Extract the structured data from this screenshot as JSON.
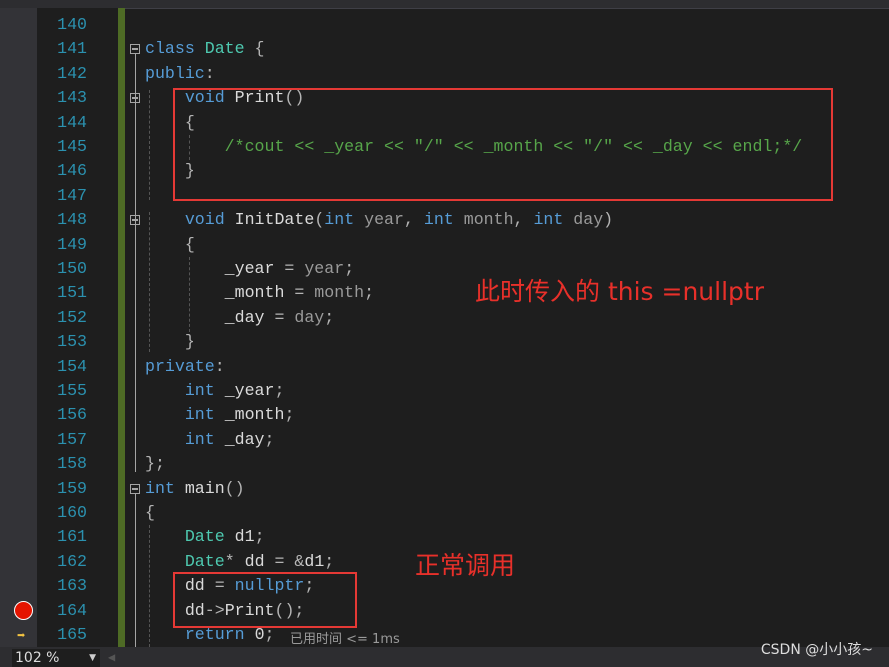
{
  "editor": {
    "lines": [
      {
        "n": "140",
        "tokens": []
      },
      {
        "n": "141",
        "tokens": [
          [
            "class ",
            "k"
          ],
          [
            "Date",
            "t"
          ],
          [
            " {",
            "o"
          ]
        ]
      },
      {
        "n": "142",
        "tokens": [
          [
            "public",
            "k"
          ],
          [
            ":",
            "o"
          ]
        ]
      },
      {
        "n": "143",
        "tokens": [
          [
            "    ",
            ""
          ],
          [
            "void ",
            "k"
          ],
          [
            "Print",
            "f"
          ],
          [
            "()",
            "o"
          ]
        ]
      },
      {
        "n": "144",
        "tokens": [
          [
            "    ",
            ""
          ],
          [
            "{",
            "o"
          ]
        ]
      },
      {
        "n": "145",
        "tokens": [
          [
            "        ",
            ""
          ],
          [
            "/*cout << _year << \"/\" << _month << \"/\" << _day << endl;*/",
            "c"
          ]
        ]
      },
      {
        "n": "146",
        "tokens": [
          [
            "    ",
            ""
          ],
          [
            "}",
            "o"
          ]
        ]
      },
      {
        "n": "147",
        "tokens": []
      },
      {
        "n": "148",
        "tokens": [
          [
            "    ",
            ""
          ],
          [
            "void ",
            "k"
          ],
          [
            "InitDate",
            "f"
          ],
          [
            "(",
            "o"
          ],
          [
            "int ",
            "k"
          ],
          [
            "year",
            "p"
          ],
          [
            ", ",
            "o"
          ],
          [
            "int ",
            "k"
          ],
          [
            "month",
            "p"
          ],
          [
            ", ",
            "o"
          ],
          [
            "int ",
            "k"
          ],
          [
            "day",
            "p"
          ],
          [
            ")",
            "o"
          ]
        ]
      },
      {
        "n": "149",
        "tokens": [
          [
            "    ",
            ""
          ],
          [
            "{",
            "o"
          ]
        ]
      },
      {
        "n": "150",
        "tokens": [
          [
            "        ",
            ""
          ],
          [
            "_year",
            "f"
          ],
          [
            " = ",
            "o"
          ],
          [
            "year",
            "p"
          ],
          [
            ";",
            "o"
          ]
        ]
      },
      {
        "n": "151",
        "tokens": [
          [
            "        ",
            ""
          ],
          [
            "_month",
            "f"
          ],
          [
            " = ",
            "o"
          ],
          [
            "month",
            "p"
          ],
          [
            ";",
            "o"
          ]
        ]
      },
      {
        "n": "152",
        "tokens": [
          [
            "        ",
            ""
          ],
          [
            "_day",
            "f"
          ],
          [
            " = ",
            "o"
          ],
          [
            "day",
            "p"
          ],
          [
            ";",
            "o"
          ]
        ]
      },
      {
        "n": "153",
        "tokens": [
          [
            "    ",
            ""
          ],
          [
            "}",
            "o"
          ]
        ]
      },
      {
        "n": "154",
        "tokens": [
          [
            "private",
            "k"
          ],
          [
            ":",
            "o"
          ]
        ]
      },
      {
        "n": "155",
        "tokens": [
          [
            "    ",
            ""
          ],
          [
            "int ",
            "k"
          ],
          [
            "_year",
            "f"
          ],
          [
            ";",
            "o"
          ]
        ]
      },
      {
        "n": "156",
        "tokens": [
          [
            "    ",
            ""
          ],
          [
            "int ",
            "k"
          ],
          [
            "_month",
            "f"
          ],
          [
            ";",
            "o"
          ]
        ]
      },
      {
        "n": "157",
        "tokens": [
          [
            "    ",
            ""
          ],
          [
            "int ",
            "k"
          ],
          [
            "_day",
            "f"
          ],
          [
            ";",
            "o"
          ]
        ]
      },
      {
        "n": "158",
        "tokens": [
          [
            "};",
            "o"
          ]
        ]
      },
      {
        "n": "159",
        "tokens": [
          [
            "int ",
            "k"
          ],
          [
            "main",
            "f"
          ],
          [
            "()",
            "o"
          ]
        ]
      },
      {
        "n": "160",
        "tokens": [
          [
            "{",
            "o"
          ]
        ]
      },
      {
        "n": "161",
        "tokens": [
          [
            "    ",
            ""
          ],
          [
            "Date ",
            "t"
          ],
          [
            "d1",
            "f"
          ],
          [
            ";",
            "o"
          ]
        ]
      },
      {
        "n": "162",
        "tokens": [
          [
            "    ",
            ""
          ],
          [
            "Date",
            "t"
          ],
          [
            "* ",
            "o"
          ],
          [
            "dd",
            "f"
          ],
          [
            " = &",
            "o"
          ],
          [
            "d1",
            "f"
          ],
          [
            ";",
            "o"
          ]
        ]
      },
      {
        "n": "163",
        "tokens": [
          [
            "    ",
            ""
          ],
          [
            "dd",
            "f"
          ],
          [
            " = ",
            "o"
          ],
          [
            "nullptr",
            "k"
          ],
          [
            ";",
            "o"
          ]
        ]
      },
      {
        "n": "164",
        "tokens": [
          [
            "    ",
            ""
          ],
          [
            "dd",
            "f"
          ],
          [
            "->",
            "o"
          ],
          [
            "Print",
            "f"
          ],
          [
            "();",
            "o"
          ]
        ]
      },
      {
        "n": "165",
        "tokens": [
          [
            "    ",
            ""
          ],
          [
            "return ",
            "k"
          ],
          [
            "0",
            "f"
          ],
          [
            ";",
            "o"
          ]
        ]
      }
    ],
    "inline_hint": "已用时间 <= 1ms"
  },
  "annotations": {
    "note1": "此时传入的 this =nullptr",
    "note2": "正常调用",
    "color": "#e53935"
  },
  "status": {
    "zoom": "102 %"
  },
  "watermark": "CSDN @小小孩~"
}
